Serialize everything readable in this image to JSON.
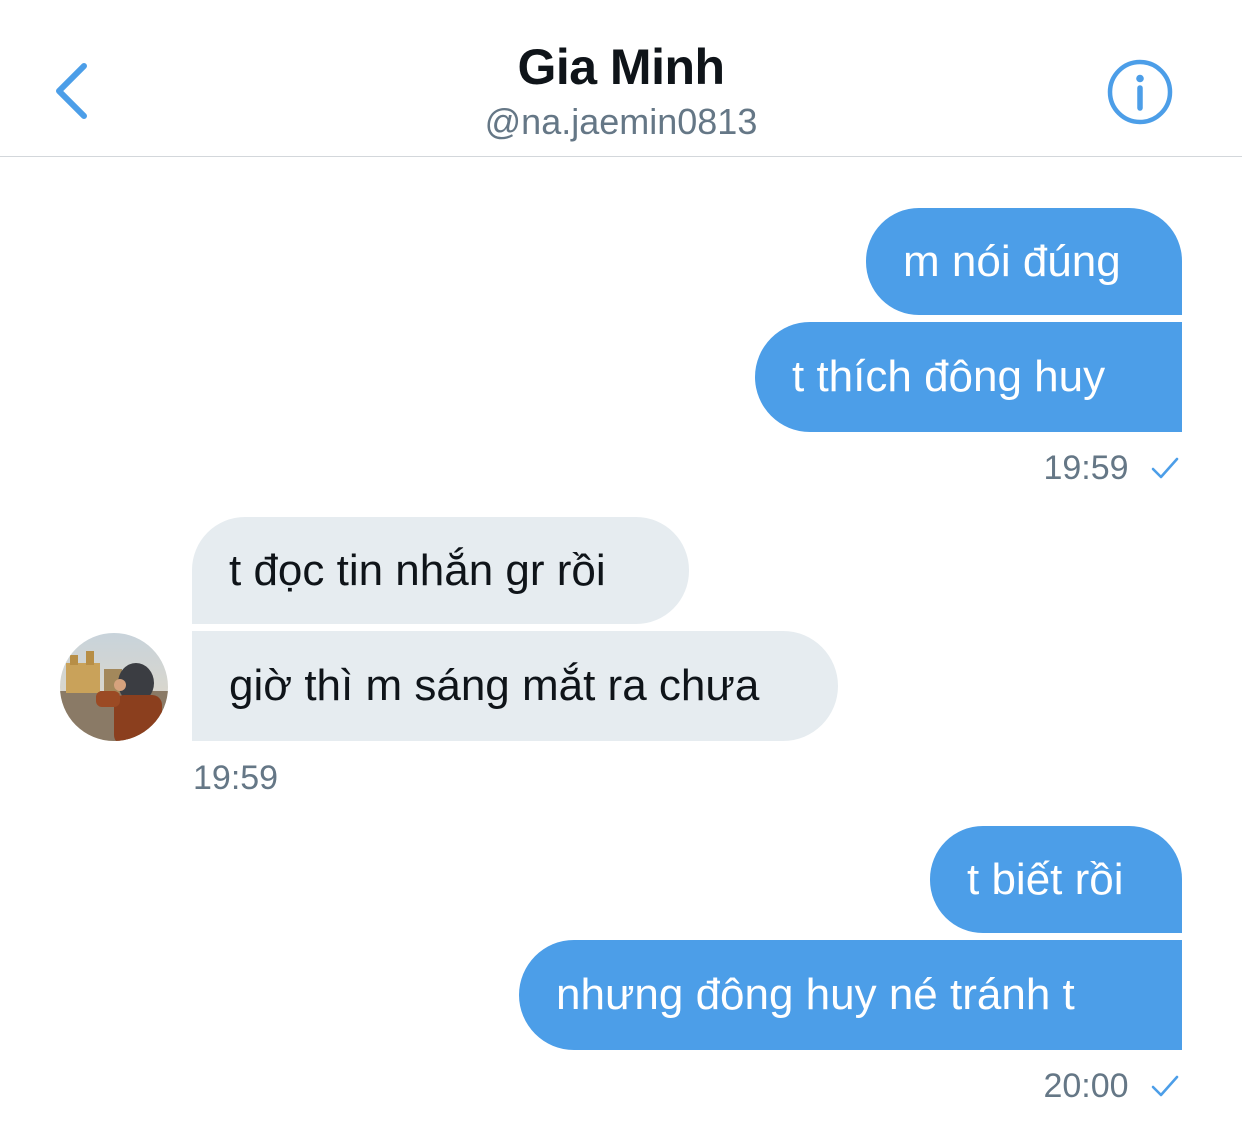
{
  "header": {
    "name": "Gia Minh",
    "handle": "@na.jaemin0813",
    "back_icon": "chevron-left-icon",
    "info_icon": "info-icon",
    "accent_color": "#4c9ee8"
  },
  "messages": [
    {
      "from": "me",
      "text": "m nói đúng"
    },
    {
      "from": "me",
      "text": "t thích đông huy"
    },
    {
      "from": "me_meta",
      "time": "19:59",
      "status_icon": "checkmark-icon"
    },
    {
      "from": "them",
      "text": "t đọc tin nhắn gr rồi"
    },
    {
      "from": "them",
      "text": "giờ thì m sáng mắt ra chưa"
    },
    {
      "from": "them_meta",
      "time": "19:59"
    },
    {
      "from": "me",
      "text": "t biết rồi"
    },
    {
      "from": "me",
      "text": "nhưng đông huy né tránh t"
    },
    {
      "from": "me_meta",
      "time": "20:00",
      "status_icon": "checkmark-icon"
    }
  ],
  "colors": {
    "sent_bubble": "#4c9ee8",
    "received_bubble": "#e6ecf0",
    "meta_text": "#657786"
  }
}
